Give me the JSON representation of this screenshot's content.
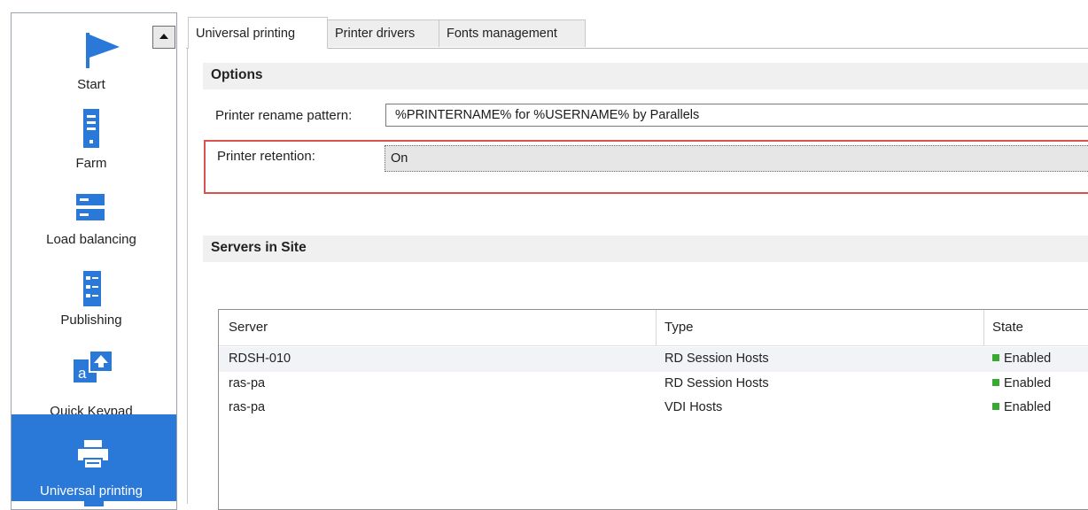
{
  "nav": {
    "items": [
      {
        "label": "Start",
        "icon": "flag-icon"
      },
      {
        "label": "Farm",
        "icon": "server-tower-icon"
      },
      {
        "label": "Load balancing",
        "icon": "load-balancing-icon"
      },
      {
        "label": "Publishing",
        "icon": "publishing-list-icon"
      },
      {
        "label": "Quick Keypad",
        "icon": "quick-keypad-icon"
      },
      {
        "label": "Universal printing",
        "icon": "printer-icon",
        "selected": true
      }
    ]
  },
  "tabs": [
    {
      "label": "Universal printing",
      "active": true
    },
    {
      "label": "Printer drivers"
    },
    {
      "label": "Fonts management"
    }
  ],
  "options": {
    "title": "Options",
    "rename_label": "Printer rename pattern:",
    "rename_value": "%PRINTERNAME% for %USERNAME% by Parallels",
    "retention_label": "Printer retention:",
    "retention_value": "On"
  },
  "servers": {
    "title": "Servers in Site",
    "columns": [
      "Server",
      "Type",
      "State"
    ],
    "rows": [
      {
        "server": "RDSH-010",
        "type": "RD Session Hosts",
        "state": "Enabled"
      },
      {
        "server": "ras-pa",
        "type": "RD Session Hosts",
        "state": "Enabled"
      },
      {
        "server": "ras-pa",
        "type": "VDI Hosts",
        "state": "Enabled"
      }
    ]
  },
  "colors": {
    "accent": "#2a79d9",
    "status_enabled": "#3aa832",
    "highlight_border": "#d9534f"
  }
}
